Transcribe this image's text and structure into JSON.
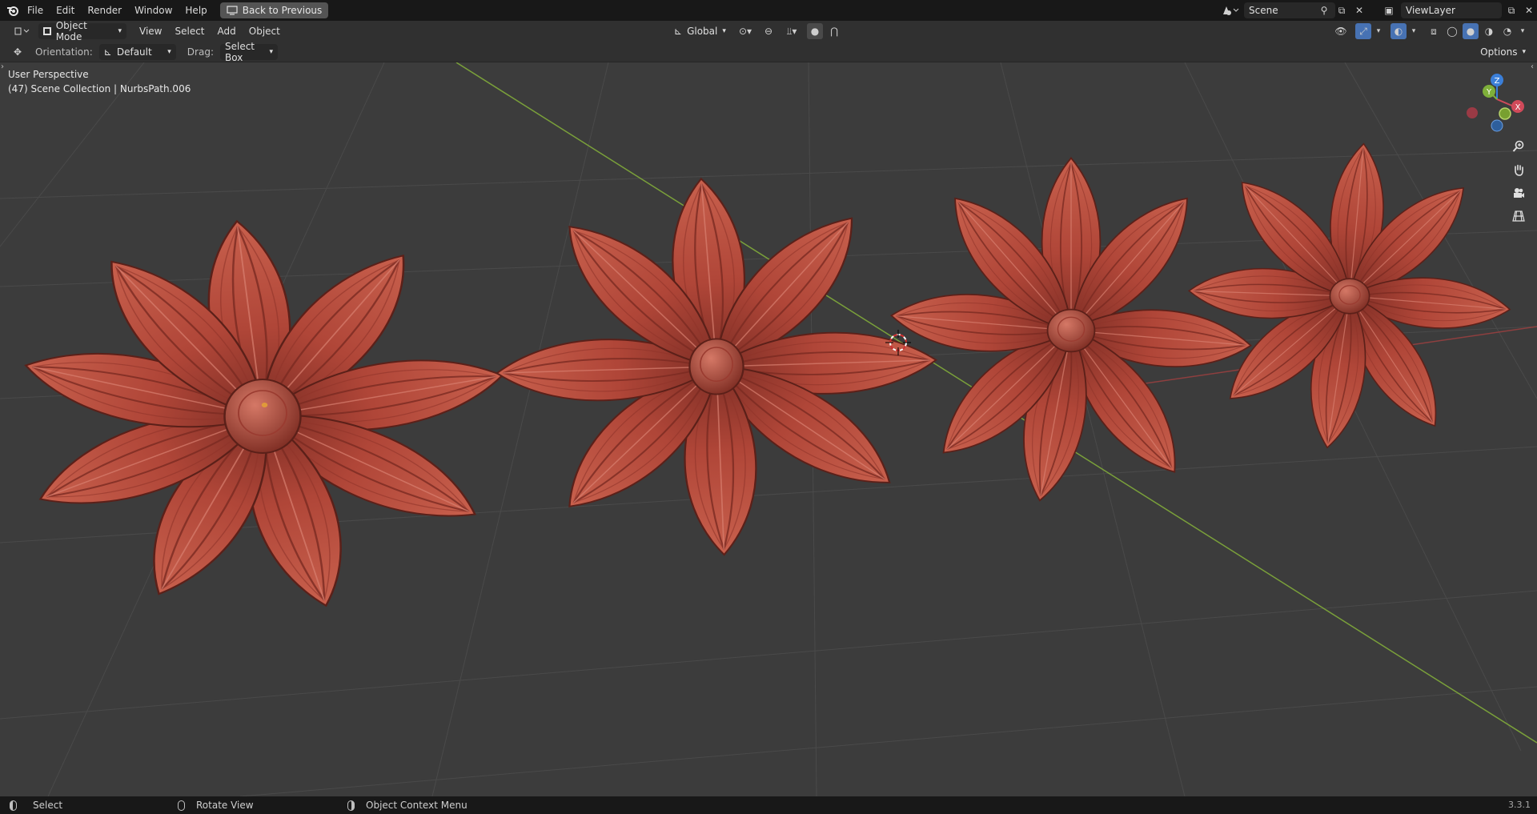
{
  "menu": {
    "file": "File",
    "edit": "Edit",
    "render": "Render",
    "window": "Window",
    "help": "Help",
    "back": "Back to Previous"
  },
  "scene": {
    "name": "Scene",
    "view_layer": "ViewLayer"
  },
  "header": {
    "mode": "Object Mode",
    "view": "View",
    "select": "Select",
    "add": "Add",
    "object": "Object",
    "transform": "Global"
  },
  "toolsettings": {
    "orientation_label": "Orientation:",
    "orientation_value": "Default",
    "drag_label": "Drag:",
    "drag_value": "Select Box",
    "options": "Options"
  },
  "viewport": {
    "perspective": "User Perspective",
    "collection": "(47) Scene Collection | NurbsPath.006"
  },
  "gizmo": {
    "z": "Z",
    "y": "Y",
    "x": "X"
  },
  "statusbar": {
    "select": "Select",
    "rotate": "Rotate View",
    "context": "Object Context Menu",
    "version": "3.3.1"
  },
  "colors": {
    "petal": "#b4493b",
    "grid": "#4a4a4a",
    "x_axis": "#8e3f3f",
    "y_axis": "#7aa03a"
  }
}
